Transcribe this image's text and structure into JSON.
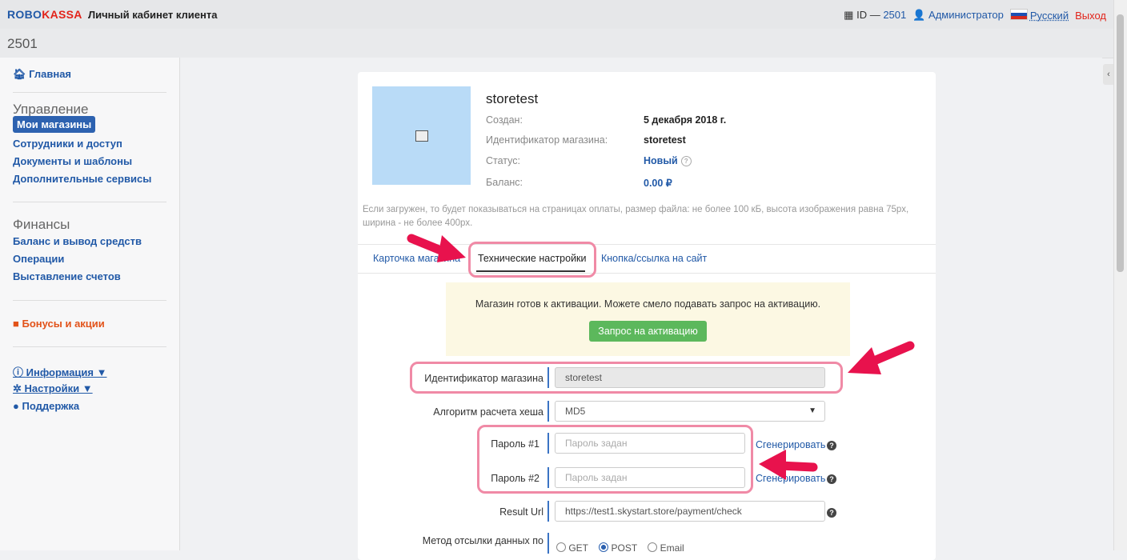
{
  "header": {
    "logo_part1": "ROBO",
    "logo_part2": "KASSA",
    "title": "Личный кабинет клиента",
    "id_label": "ID",
    "id_value": "2501",
    "user": "Администратор",
    "language": "Русский",
    "logout": "Выход"
  },
  "subheader": {
    "title": "2501"
  },
  "sidebar": {
    "home": "Главная",
    "section_manage": "Управление",
    "my_shops": "Мои магазины",
    "staff": "Сотрудники и доступ",
    "docs": "Документы и шаблоны",
    "extra": "Дополнительные сервисы",
    "section_finance": "Финансы",
    "balance": "Баланс и вывод средств",
    "operations": "Операции",
    "invoices": "Выставление счетов",
    "bonuses": "Бонусы и акции",
    "info": "Информация ▼",
    "settings": "Настройки ▼",
    "support": "Поддержка"
  },
  "shop": {
    "name": "storetest",
    "created_label": "Создан:",
    "created_value": "5 декабря 2018 г.",
    "id_label": "Идентификатор магазина:",
    "id_value": "storetest",
    "status_label": "Статус:",
    "status_value": "Новый",
    "balance_label": "Баланс:",
    "balance_value": "0.00 ₽",
    "note": "Если загружен, то будет показываться на страницах оплаты, размер файла: не более 100 кБ, высота изображения равна 75px, ширина - не более 400px."
  },
  "tabs": {
    "card": "Карточка магазина",
    "tech": "Технические настройки",
    "button": "Кнопка/ссылка на сайт"
  },
  "alert": {
    "text": "Магазин готов к активации. Можете смело подавать запрос на активацию.",
    "button": "Запрос на активацию"
  },
  "form": {
    "shop_id_label": "Идентификатор магазина",
    "shop_id_value": "storetest",
    "hash_label": "Алгоритм расчета хеша",
    "hash_value": "MD5",
    "pass1_label": "Пароль #1",
    "pass1_placeholder": "Пароль задан",
    "pass2_label": "Пароль #2",
    "pass2_placeholder": "Пароль задан",
    "generate": "Сгенерировать",
    "result_url_label": "Result Url",
    "result_url_value": "https://test1.skystart.store/payment/check",
    "method_label": "Метод отсылки данных по",
    "method_get": "GET",
    "method_post": "POST",
    "method_email": "Email"
  },
  "colors": {
    "brand_blue": "#2159a7",
    "brand_red": "#e2231a",
    "highlight": "#f08aa6",
    "arrow": "#e8124d",
    "success": "#5cb85c"
  }
}
